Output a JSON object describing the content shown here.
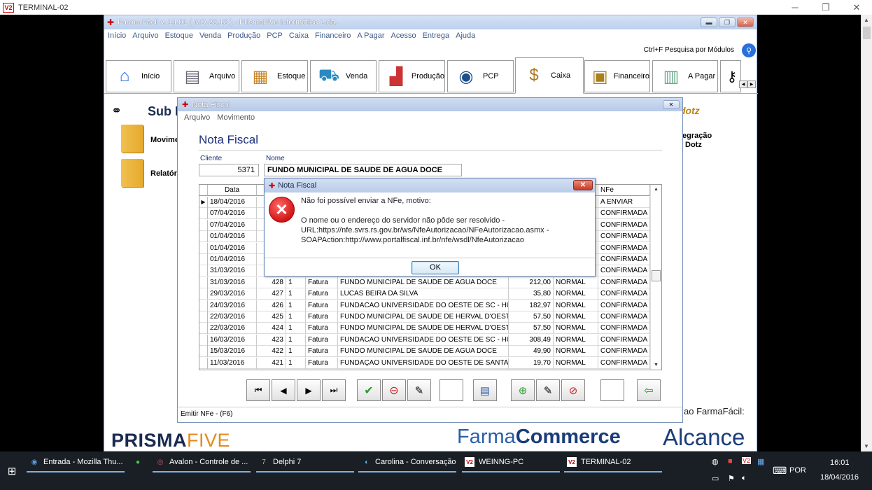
{
  "remote": {
    "title": "TERMINAL-02",
    "logo_text": "V2",
    "controls": [
      "─",
      "❐",
      "✕"
    ]
  },
  "app": {
    "title": "Farma Fácil v. 14.01 ( MD-23.13 ) - PrismaFive Informática Ltda.",
    "menu": [
      "Início",
      "Arquivo",
      "Estoque",
      "Venda",
      "Produção",
      "PCP",
      "Caixa",
      "Financeiro",
      "A Pagar",
      "Acesso",
      "Entrega",
      "Ajuda"
    ],
    "search_label": "Ctrl+F Pesquisa por Módulos",
    "modules": [
      {
        "label": "Início",
        "icon": "house-icon"
      },
      {
        "label": "Arquivo",
        "icon": "printer-icon"
      },
      {
        "label": "Estoque",
        "icon": "boxes-icon"
      },
      {
        "label": "Venda",
        "icon": "cart-icon"
      },
      {
        "label": "Produção",
        "icon": "factory-icon"
      },
      {
        "label": "PCP",
        "icon": "pcp-icon"
      },
      {
        "label": "Caixa",
        "icon": "money-bag-icon"
      },
      {
        "label": "Financeiro",
        "icon": "safe-icon"
      },
      {
        "label": "A Pagar",
        "icon": "invoice-icon"
      }
    ],
    "active_module": "Caixa",
    "sub_title": "Sub M",
    "sub_items": [
      "Movime",
      "Relatóri"
    ],
    "dotz": "dotz",
    "integration": [
      "egração",
      "Dotz"
    ],
    "footer_text": "ao FarmaFácil:",
    "logos": {
      "prisma": "PRISMA",
      "five": "FIVE",
      "farma": "Farma",
      "commerce": "Commerce",
      "alcance": "Alcance"
    }
  },
  "nf": {
    "title": "Nota Fiscal",
    "menu": [
      "Arquivo",
      "Movimento"
    ],
    "heading": "Nota Fiscal",
    "cliente_label": "Cliente",
    "nome_label": "Nome",
    "cliente_value": "5371",
    "nome_value": "FUNDO MUNICIPAL DE SAUDE DE AGUA DOCE",
    "columns": [
      "Data",
      "NFe"
    ],
    "rows": [
      {
        "data": "18/04/2016",
        "num": "",
        "s": "",
        "tipo": "",
        "cliente": "",
        "valor": "",
        "forma": "",
        "nfe": "A ENVIAR"
      },
      {
        "data": "07/04/2016",
        "num": "",
        "s": "",
        "tipo": "",
        "cliente": "",
        "valor": "",
        "forma": "",
        "nfe": "CONFIRMADA"
      },
      {
        "data": "07/04/2016",
        "num": "",
        "s": "",
        "tipo": "",
        "cliente": "",
        "valor": "",
        "forma": "",
        "nfe": "CONFIRMADA"
      },
      {
        "data": "01/04/2016",
        "num": "",
        "s": "",
        "tipo": "",
        "cliente": "",
        "valor": "",
        "forma": "",
        "nfe": "CONFIRMADA"
      },
      {
        "data": "01/04/2016",
        "num": "",
        "s": "",
        "tipo": "",
        "cliente": "",
        "valor": "",
        "forma": "",
        "nfe": "CONFIRMADA"
      },
      {
        "data": "01/04/2016",
        "num": "",
        "s": "",
        "tipo": "",
        "cliente": "",
        "valor": "",
        "forma": "",
        "nfe": "CONFIRMADA"
      },
      {
        "data": "31/03/2016",
        "num": "",
        "s": "",
        "tipo": "",
        "cliente": "",
        "valor": "",
        "forma": "",
        "nfe": "CONFIRMADA"
      },
      {
        "data": "31/03/2016",
        "num": "428",
        "s": "1",
        "tipo": "Fatura",
        "cliente": "FUNDO MUNICIPAL DE SAUDE DE AGUA DOCE",
        "valor": "212,00",
        "forma": "NORMAL",
        "nfe": "CONFIRMADA"
      },
      {
        "data": "29/03/2016",
        "num": "427",
        "s": "1",
        "tipo": "Fatura",
        "cliente": "LUCAS BEIRA DA SILVA",
        "valor": "35,80",
        "forma": "NORMAL",
        "nfe": "CONFIRMADA"
      },
      {
        "data": "24/03/2016",
        "num": "426",
        "s": "1",
        "tipo": "Fatura",
        "cliente": "FUNDACAO UNIVERSIDADE DO OESTE DE SC - HUS",
        "valor": "182,97",
        "forma": "NORMAL",
        "nfe": "CONFIRMADA"
      },
      {
        "data": "22/03/2016",
        "num": "425",
        "s": "1",
        "tipo": "Fatura",
        "cliente": "FUNDO MUNICIPAL DE SAUDE DE HERVAL D'OEST",
        "valor": "57,50",
        "forma": "NORMAL",
        "nfe": "CONFIRMADA"
      },
      {
        "data": "22/03/2016",
        "num": "424",
        "s": "1",
        "tipo": "Fatura",
        "cliente": "FUNDO MUNICIPAL DE SAUDE DE HERVAL D'OEST",
        "valor": "57,50",
        "forma": "NORMAL",
        "nfe": "CONFIRMADA"
      },
      {
        "data": "16/03/2016",
        "num": "423",
        "s": "1",
        "tipo": "Fatura",
        "cliente": "FUNDACAO UNIVERSIDADE DO OESTE DE SC - HUS",
        "valor": "308,49",
        "forma": "NORMAL",
        "nfe": "CONFIRMADA"
      },
      {
        "data": "15/03/2016",
        "num": "422",
        "s": "1",
        "tipo": "Fatura",
        "cliente": "FUNDO MUNICIPAL DE SAUDE DE AGUA DOCE",
        "valor": "49,90",
        "forma": "NORMAL",
        "nfe": "CONFIRMADA"
      },
      {
        "data": "11/03/2016",
        "num": "421",
        "s": "1",
        "tipo": "Fatura",
        "cliente": "FUNDAÇAO UNIVERSIDADE DO OESTE DE SANTA C",
        "valor": "19,70",
        "forma": "NORMAL",
        "nfe": "CONFIRMADA"
      }
    ],
    "status": "Emitir NFe - (F6)"
  },
  "dialog": {
    "title": "Nota Fiscal",
    "close": "✕",
    "message": "Não foi possível enviar a NFe, motivo:\n\nO nome ou o endereço do servidor não pôde ser resolvido -\nURL:https://nfe.svrs.rs.gov.br/ws/NfeAutorizacao/NFeAutorizacao.asmx -\nSOAPAction:http://www.portalfiscal.inf.br/nfe/wsdl/NfeAutorizacao",
    "ok": "OK"
  },
  "taskbar": {
    "items": [
      {
        "label": "Entrada - Mozilla Thu...",
        "icon": "thunderbird-icon"
      },
      {
        "label": "",
        "icon": "green-app-icon"
      },
      {
        "label": "Avalon - Controle de ...",
        "icon": "chrome-icon"
      },
      {
        "label": "Delphi 7",
        "icon": "delphi-icon"
      },
      {
        "label": "Carolina - Conversação",
        "icon": "chat-icon"
      },
      {
        "label": "WEINNG-PC",
        "icon": "remote-icon"
      },
      {
        "label": "TERMINAL-02",
        "icon": "remote-icon"
      }
    ],
    "lang": "POR",
    "time": "16:01",
    "date": "18/04/2016"
  }
}
